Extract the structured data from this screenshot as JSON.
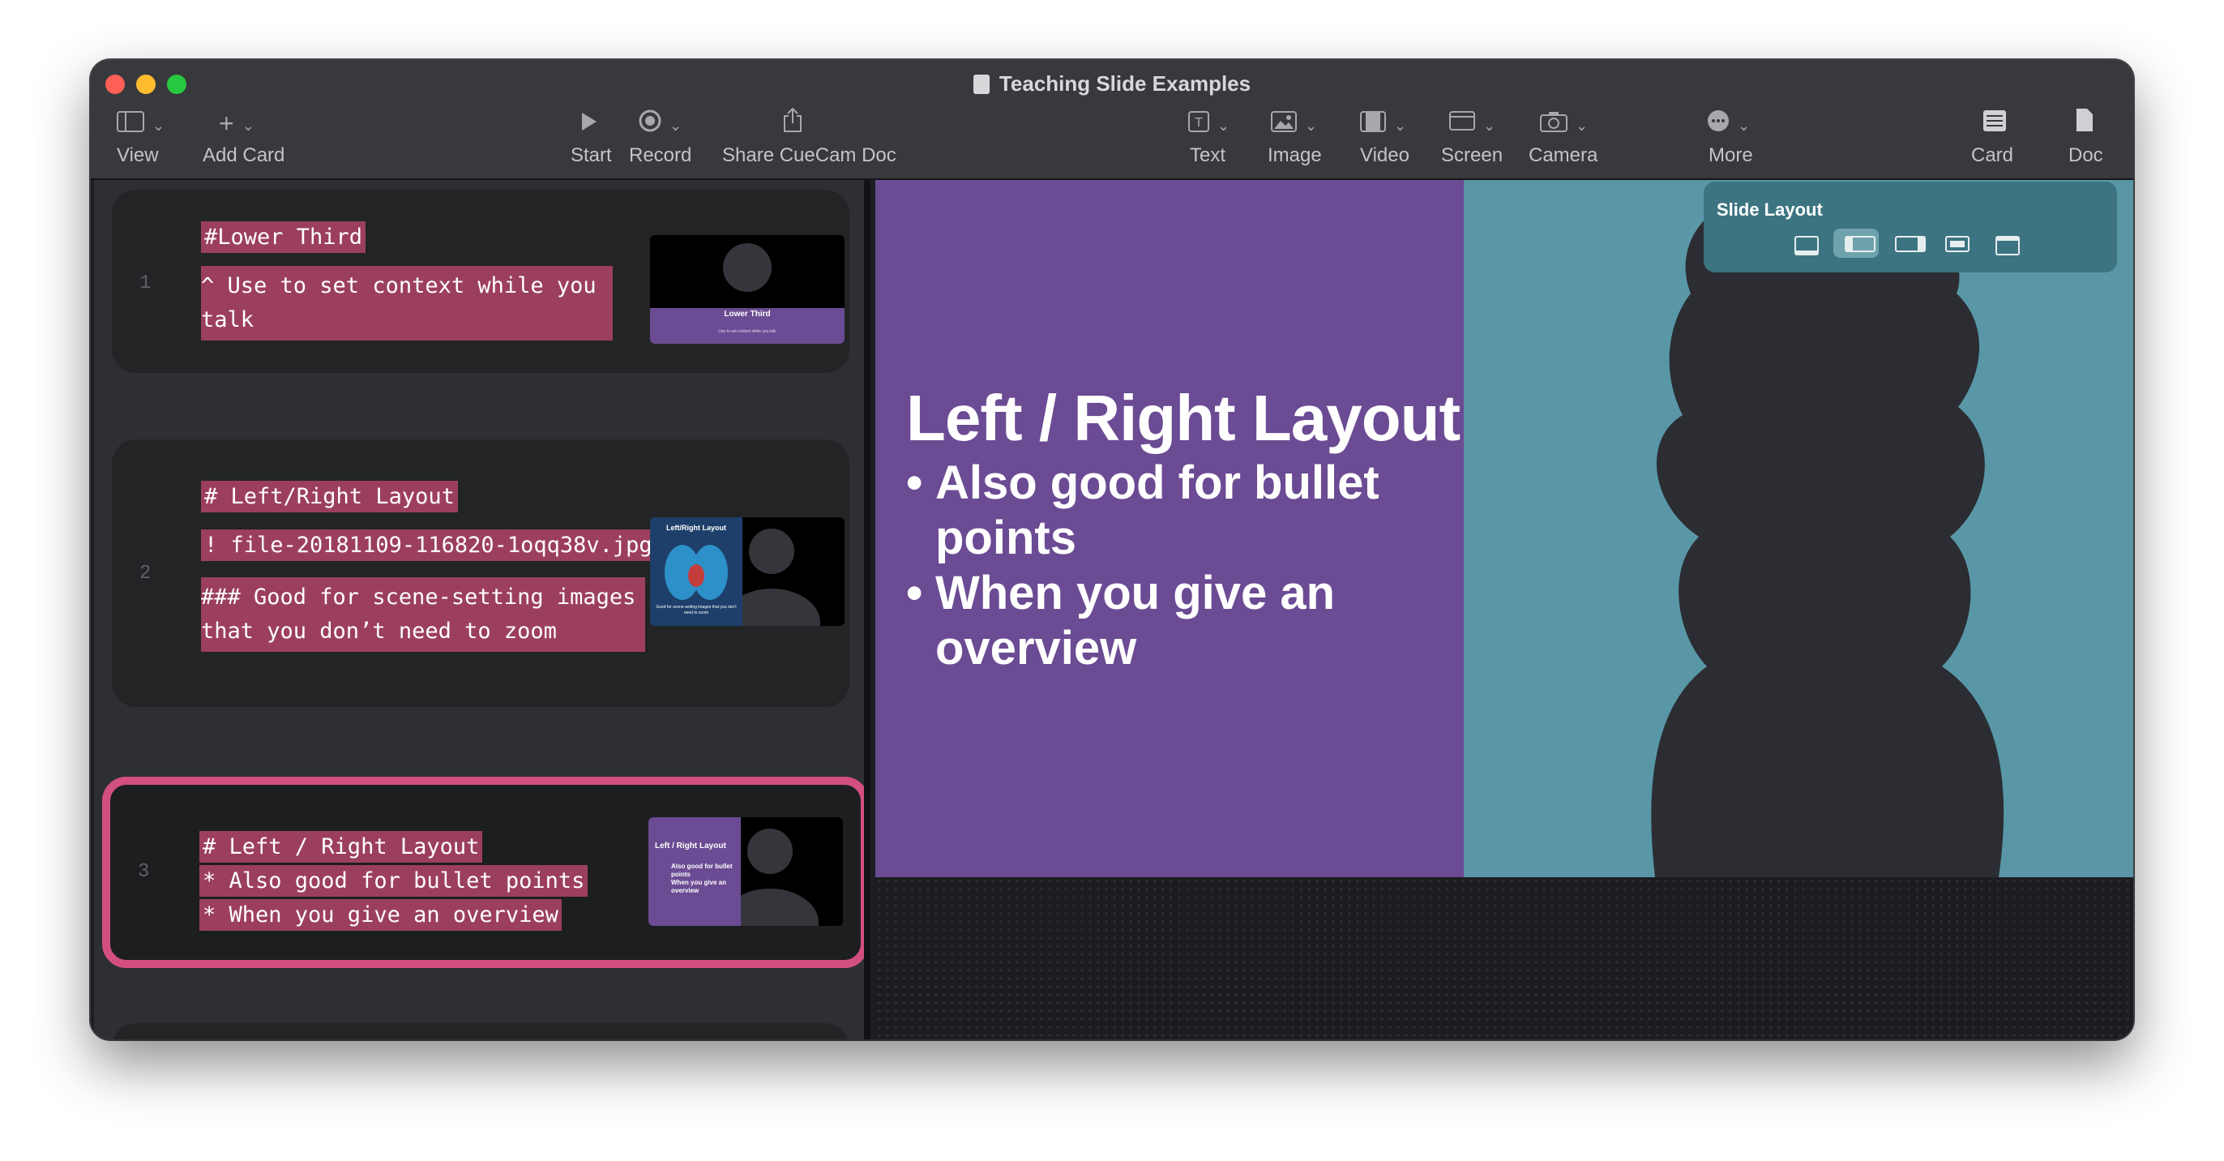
{
  "window": {
    "title": "Teaching Slide Examples"
  },
  "toolbar": {
    "view": "View",
    "add_card": "Add Card",
    "start": "Start",
    "record": "Record",
    "share": "Share CueCam Doc",
    "text": "Text",
    "image": "Image",
    "video": "Video",
    "screen": "Screen",
    "camera": "Camera",
    "more": "More",
    "card": "Card",
    "doc": "Doc"
  },
  "cards": [
    {
      "number": "1",
      "lines": [
        "#Lower Third",
        "^ Use to set context while you",
        "talk"
      ],
      "thumb_title": "Lower Third",
      "thumb_sub": "Use to set context while you talk"
    },
    {
      "number": "2",
      "lines": [
        "# Left/Right Layout",
        "! file-20181109-116820-1oqq38v.jpg",
        "### Good for scene-setting images",
        "that you don’t need to zoom"
      ],
      "thumb_title": "Left/Right Layout",
      "thumb_sub": "Good for scene-setting images that you don't need to zoom"
    },
    {
      "number": "3",
      "lines": [
        "# Left / Right Layout",
        "* Also good for bullet points",
        "* When you give an overview"
      ],
      "thumb_title": "Left / Right Layout",
      "thumb_bullets": [
        "Also good for bullet points",
        "When you give an overview"
      ]
    }
  ],
  "slide": {
    "title": "Left / Right Layout",
    "bullets": [
      "Also good for bullet points",
      "When you give an overview"
    ]
  },
  "slide_layout_panel": {
    "title": "Slide Layout",
    "options": [
      "lower-third",
      "left-right",
      "right-left",
      "inset",
      "banner"
    ],
    "active": "left-right"
  },
  "colors": {
    "accent": "#d34f80",
    "highlight": "#9c3f5e",
    "slide_purple": "#6b4b93",
    "slide_teal": "#5997a7"
  }
}
